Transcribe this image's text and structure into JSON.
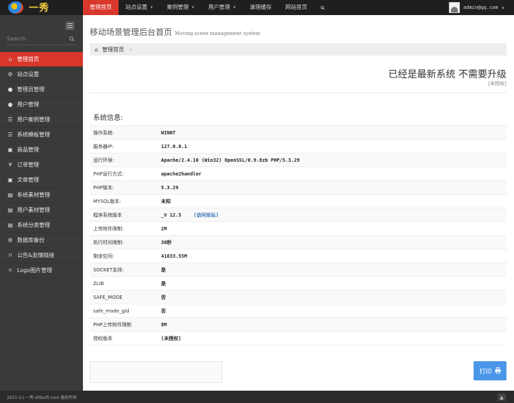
{
  "logo": {
    "text": "一秀"
  },
  "nav": [
    {
      "label": "管理首页",
      "caret": ""
    },
    {
      "label": "站点设置",
      "caret": "∨"
    },
    {
      "label": "案例管理",
      "caret": "∨"
    },
    {
      "label": "用户管理",
      "caret": "∨"
    },
    {
      "label": "清理缓存",
      "caret": ""
    },
    {
      "label": "网站首页",
      "caret": ""
    }
  ],
  "user": {
    "name": "admin@qq.com"
  },
  "sidebar": {
    "search_placeholder": "Search",
    "items": [
      {
        "label": "管理首页",
        "icon": "home-icon"
      },
      {
        "label": "站点设置",
        "icon": "cogs-icon"
      },
      {
        "label": "管理员管理",
        "icon": "user-icon"
      },
      {
        "label": "用户管理",
        "icon": "user-icon"
      },
      {
        "label": "用户案例管理",
        "icon": "list-icon"
      },
      {
        "label": "系统模板管理",
        "icon": "list-icon"
      },
      {
        "label": "商品管理",
        "icon": "box-icon"
      },
      {
        "label": "订单管理",
        "icon": "yen-icon"
      },
      {
        "label": "文章管理",
        "icon": "box-icon"
      },
      {
        "label": "系统素材管理",
        "icon": "briefcase-icon"
      },
      {
        "label": "用户素材管理",
        "icon": "briefcase-icon"
      },
      {
        "label": "系统分类管理",
        "icon": "briefcase-icon"
      },
      {
        "label": "数据库备份",
        "icon": "cogs-icon"
      },
      {
        "label": "公告&友情链接",
        "icon": "bookmark-icon"
      },
      {
        "label": "Logo图片管理",
        "icon": "bookmark-icon"
      }
    ]
  },
  "page": {
    "title": "移动场景管理后台首页",
    "subtitle": "Moving scene management system",
    "breadcrumb": "管理首页",
    "upgrade_msg": "已经是最新系统 不需要升级",
    "unauthorized": "[未授权]",
    "info_title": "系统信息:"
  },
  "info": [
    {
      "key": "操作系统:",
      "value": "WINNT"
    },
    {
      "key": "服务器IP:",
      "value": "127.0.0.1"
    },
    {
      "key": "运行环境:",
      "value": "Apache/2.4.10 (Win32) OpenSSL/0.9.8zb PHP/5.3.29"
    },
    {
      "key": "PHP运行方式:",
      "value": "apache2handler"
    },
    {
      "key": "PHP版本:",
      "value": "5.3.29"
    },
    {
      "key": "MYSQL版本:",
      "value": "未知"
    },
    {
      "key": "程序系统版本",
      "value": "_V 12.5",
      "link": "[访问论坛]"
    },
    {
      "key": "上传附件限制:",
      "value": "2M"
    },
    {
      "key": "执行时间限制:",
      "value": "30秒"
    },
    {
      "key": "剩余空间:",
      "value": "41033.55M"
    },
    {
      "key": "SOCKET支持:",
      "value": "是"
    },
    {
      "key": "ZLIB",
      "value": "是"
    },
    {
      "key": "SAFE_MODE",
      "value": "否"
    },
    {
      "key": "safe_mode_gid",
      "value": "否"
    },
    {
      "key": "PHP上传附件限制",
      "value": "8M"
    },
    {
      "key": "授权版本",
      "value": "[未授权]"
    }
  ],
  "print_label": "打印",
  "footer": "2015 (c) 一秀 efdsoft.com 版权所有"
}
